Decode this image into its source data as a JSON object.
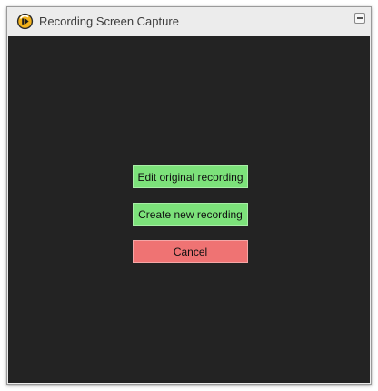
{
  "window": {
    "title": "Recording Screen Capture",
    "app_icon": "camtasia-logo-icon",
    "minimize_icon": "minimize-icon"
  },
  "actions": {
    "edit_label": "Edit original recording",
    "create_label": "Create new recording",
    "cancel_label": "Cancel"
  },
  "colors": {
    "content_bg": "#232323",
    "confirm_button": "#7ce27a",
    "cancel_button": "#ef7373",
    "titlebar_bg": "#ececec"
  }
}
